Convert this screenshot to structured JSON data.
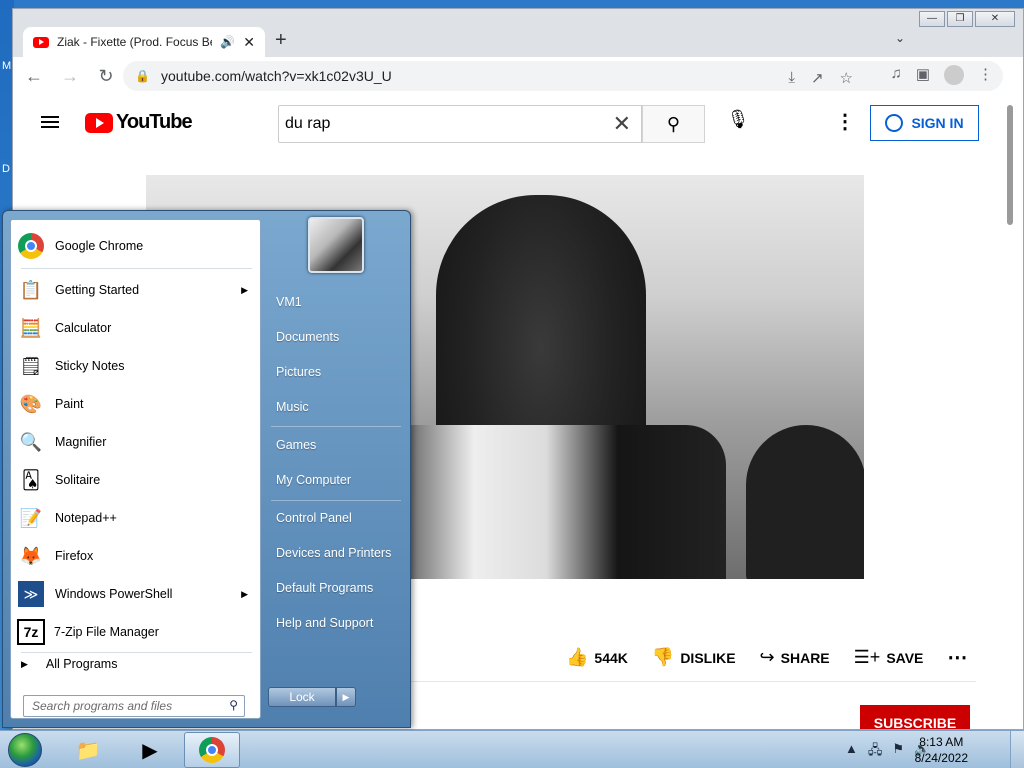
{
  "desktop": {
    "edge_letters": [
      "M",
      "D"
    ]
  },
  "chrome": {
    "tab_title": "Ziak - Fixette (Prod. Focus Be",
    "url": "youtube.com/watch?v=xk1c02v3U_U"
  },
  "youtube": {
    "logo_text": "YouTube",
    "search_value": "du rap",
    "signin_label": "SIGN IN",
    "actions": {
      "likes": "544K",
      "dislike": "DISLIKE",
      "share": "SHARE",
      "save": "SAVE"
    },
    "subscribe_label": "SUBSCRIBE"
  },
  "start_menu": {
    "programs": [
      {
        "label": "Google Chrome",
        "icon": "chrome-icon",
        "submenu": false
      },
      {
        "label": "Getting Started",
        "icon": "getting-started-icon",
        "submenu": true
      },
      {
        "label": "Calculator",
        "icon": "calculator-icon",
        "submenu": false
      },
      {
        "label": "Sticky Notes",
        "icon": "sticky-notes-icon",
        "submenu": false
      },
      {
        "label": "Paint",
        "icon": "paint-icon",
        "submenu": false
      },
      {
        "label": "Magnifier",
        "icon": "magnifier-icon",
        "submenu": false
      },
      {
        "label": "Solitaire",
        "icon": "solitaire-icon",
        "submenu": false
      },
      {
        "label": "Notepad++",
        "icon": "notepadpp-icon",
        "submenu": false
      },
      {
        "label": "Firefox",
        "icon": "firefox-icon",
        "submenu": false
      },
      {
        "label": "Windows PowerShell",
        "icon": "powershell-icon",
        "submenu": true
      },
      {
        "label": "7-Zip File Manager",
        "icon": "7zip-icon",
        "submenu": false
      }
    ],
    "all_programs": "All Programs",
    "search_placeholder": "Search programs and files",
    "right_items": [
      "VM1",
      "Documents",
      "Pictures",
      "Music",
      "Games",
      "My Computer",
      "Control Panel",
      "Devices and Printers",
      "Default Programs",
      "Help and Support"
    ],
    "lock_label": "Lock"
  },
  "taskbar": {
    "time": "8:13 AM",
    "date": "8/24/2022"
  }
}
